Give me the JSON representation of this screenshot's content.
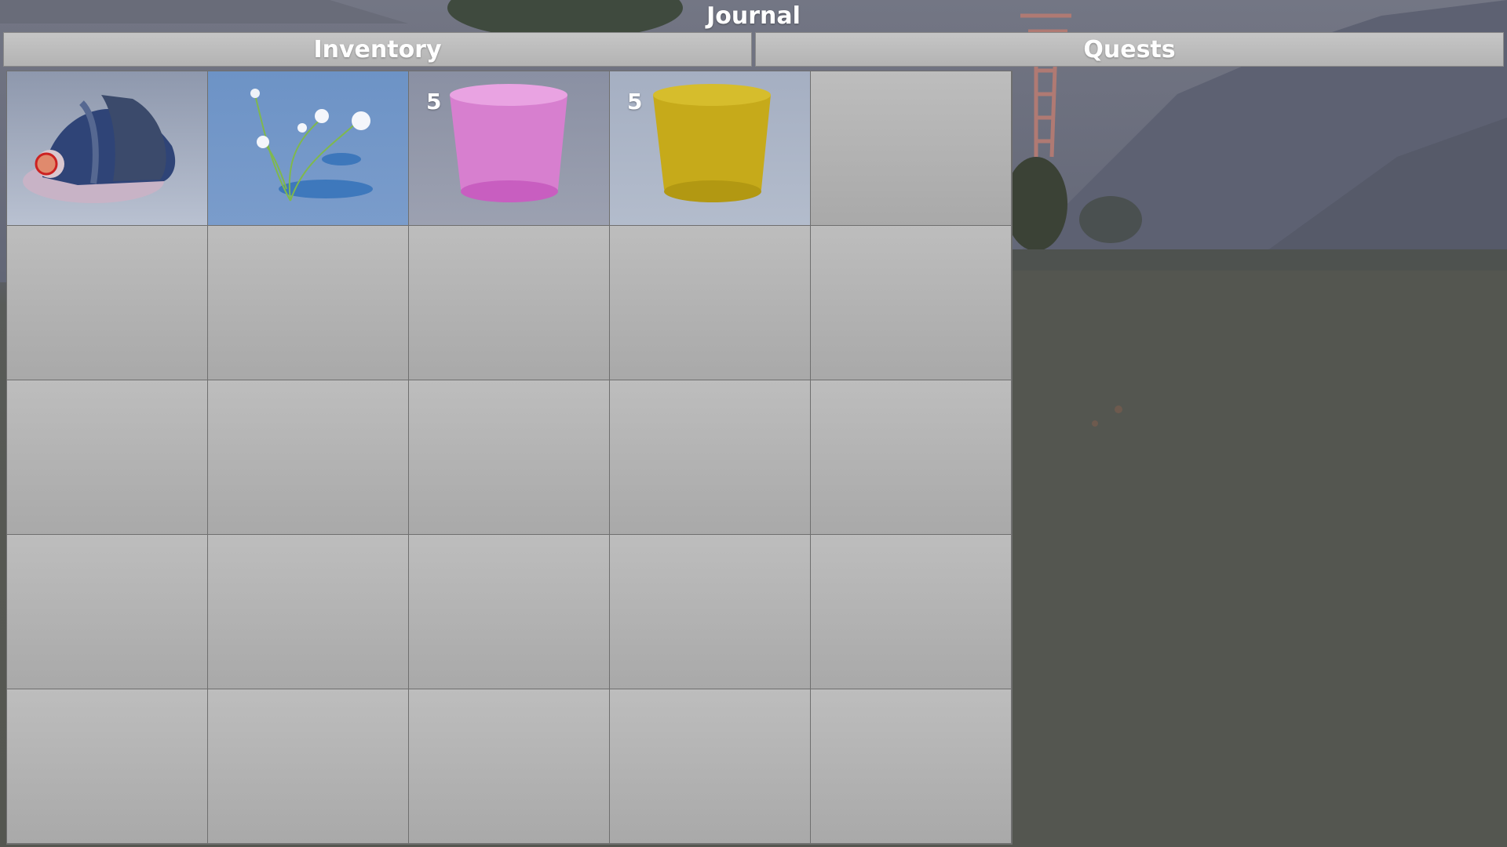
{
  "window": {
    "title": "Journal"
  },
  "tabs": [
    {
      "label": "Inventory",
      "active": true
    },
    {
      "label": "Quests",
      "active": false
    }
  ],
  "inventory": {
    "columns": 5,
    "rows": 5,
    "slots": [
      {
        "item": "miner-helmet-icon",
        "count": ""
      },
      {
        "item": "white-flower-sprig-icon",
        "count": ""
      },
      {
        "item": "pink-bucket-icon",
        "count": "5",
        "color": "#d77fcf"
      },
      {
        "item": "yellow-bucket-icon",
        "count": "5",
        "color": "#c6aa1a"
      },
      {
        "item": "",
        "count": ""
      }
    ]
  },
  "colors": {
    "tab_fill": "#bebebe",
    "slot_fill": "#b2b2b2",
    "text": "#ffffff"
  }
}
